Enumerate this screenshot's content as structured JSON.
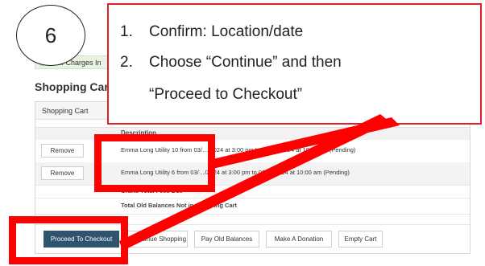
{
  "step": {
    "number": "6"
  },
  "notice": {
    "text": "New Charges In",
    "icon": "info-circle-icon"
  },
  "page": {
    "title": "Shopping Cart"
  },
  "cart": {
    "panel_title": "Shopping Cart",
    "column_header": "Description",
    "rows": [
      {
        "action": "Remove",
        "description": "Emma Long Utility 10 from 03/…/2024 at 3:00 pm to 0…/…/2024 at 10:00 am (Pending)"
      },
      {
        "action": "Remove",
        "description": "Emma Long Utility 6 from 03/…/2024 at 3:00 pm to 03/…/2024 at 10:00 am (Pending)"
      }
    ],
    "grand_total_label": "Grand Total Fees Due",
    "old_balances_label": "Total Old Balances Not in Shopping Cart"
  },
  "actions": {
    "proceed": "Proceed To Checkout",
    "continue": "Continue Shopping",
    "pay_old": "Pay Old Balances",
    "donate": "Make A Donation",
    "empty": "Empty Cart"
  },
  "callout": {
    "items": [
      {
        "num": "1.",
        "text": "Confirm: Location/date"
      },
      {
        "num": "2.",
        "text": "Choose “Continue” and then"
      },
      {
        "num": "",
        "text": "“Proceed to Checkout”"
      }
    ]
  },
  "colors": {
    "highlight": "#ff0000",
    "primary_button": "#2e5470",
    "callout_border": "#e0202a"
  }
}
